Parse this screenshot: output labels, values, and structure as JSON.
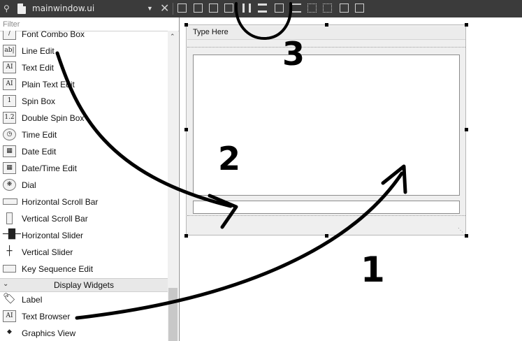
{
  "toolbar": {
    "file_name": "mainwindow.ui",
    "icons": [
      "file-icon",
      "dropdown-arrow-icon",
      "close-icon"
    ]
  },
  "widget_box": {
    "filter_placeholder": "Filter",
    "items": [
      {
        "label": "Font Combo Box",
        "icon": "font-combo-box-icon"
      },
      {
        "label": "Line Edit",
        "icon": "line-edit-icon"
      },
      {
        "label": "Text Edit",
        "icon": "text-edit-icon"
      },
      {
        "label": "Plain Text Edit",
        "icon": "plain-text-edit-icon"
      },
      {
        "label": "Spin Box",
        "icon": "spin-box-icon"
      },
      {
        "label": "Double Spin Box",
        "icon": "double-spin-box-icon"
      },
      {
        "label": "Time Edit",
        "icon": "clock-icon"
      },
      {
        "label": "Date Edit",
        "icon": "calendar-icon"
      },
      {
        "label": "Date/Time Edit",
        "icon": "calendar-clock-icon"
      },
      {
        "label": "Dial",
        "icon": "dial-icon"
      },
      {
        "label": "Horizontal Scroll Bar",
        "icon": "horizontal-scroll-bar-icon"
      },
      {
        "label": "Vertical Scroll Bar",
        "icon": "vertical-scroll-bar-icon"
      },
      {
        "label": "Horizontal Slider",
        "icon": "horizontal-slider-icon"
      },
      {
        "label": "Vertical Slider",
        "icon": "vertical-slider-icon"
      },
      {
        "label": "Key Sequence Edit",
        "icon": "key-sequence-edit-icon"
      }
    ],
    "category": "Display Widgets",
    "display_items": [
      {
        "label": "Label",
        "icon": "label-tag-icon"
      },
      {
        "label": "Text Browser",
        "icon": "text-browser-icon"
      },
      {
        "label": "Graphics View",
        "icon": "graphics-view-icon"
      }
    ]
  },
  "form": {
    "menu_placeholder": "Type Here"
  },
  "annotations": {
    "step1": "1",
    "step2": "2",
    "step3": "3"
  },
  "colors": {
    "toolbar_bg": "#3b3b3b",
    "annotation_stroke": "#000000"
  }
}
